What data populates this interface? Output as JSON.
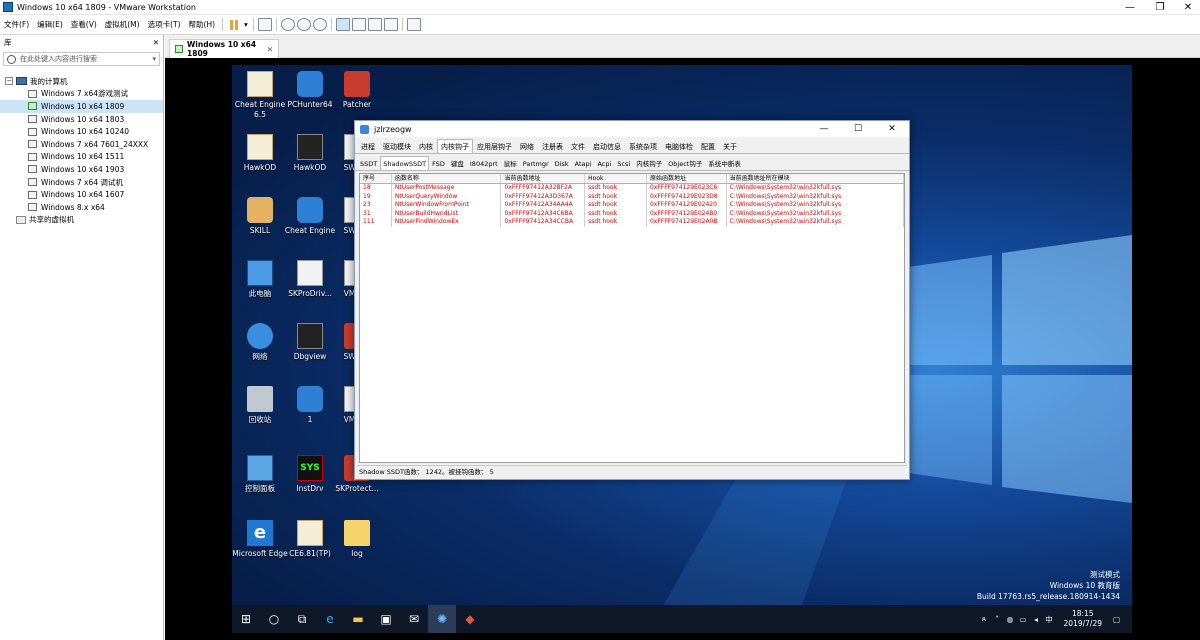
{
  "window": {
    "title": "Windows 10 x64 1809 - VMware Workstation",
    "minimize": "—",
    "maximize": "❐",
    "close": "✕"
  },
  "menu": [
    "文件(F)",
    "编辑(E)",
    "查看(V)",
    "虚拟机(M)",
    "选项卡(T)",
    "帮助(H)"
  ],
  "library": {
    "title": "库",
    "close": "✕",
    "search_placeholder": "在此处键入内容进行搜索",
    "root": "我的计算机",
    "vms": [
      {
        "label": "Windows 7 x64游戏测试",
        "running": false
      },
      {
        "label": "Windows 10 x64 1809",
        "running": true,
        "selected": true
      },
      {
        "label": "Windows 10 x64 1803",
        "running": false
      },
      {
        "label": "Windows 10 x64 10240",
        "running": false
      },
      {
        "label": "Windows 7 x64 7601_24XXX",
        "running": false
      },
      {
        "label": "Windows 10 x64 1511",
        "running": false
      },
      {
        "label": "Windows 10 x64 1903",
        "running": false
      },
      {
        "label": "Windows 7 x64 调试机",
        "running": false
      },
      {
        "label": "Windows 10 x64 1607",
        "running": false
      },
      {
        "label": "Windows 8.x x64",
        "running": false
      }
    ],
    "shared": "共享的虚拟机"
  },
  "vm_tab": {
    "label": "Windows 10 x64 1809",
    "close": "✕"
  },
  "desktop": {
    "icons": [
      {
        "label": "Cheat Engine 6.5",
        "glyph": "doc"
      },
      {
        "label": "PCHunter64",
        "glyph": "blue"
      },
      {
        "label": "Patcher",
        "glyph": "pkg"
      },
      {
        "label": "HawkOD",
        "glyph": "doc"
      },
      {
        "label": "HawkOD",
        "glyph": "dark"
      },
      {
        "label": "SWProt",
        "glyph": "file"
      },
      {
        "label": "SKILL",
        "glyph": "user"
      },
      {
        "label": "Cheat Engine",
        "glyph": "blue"
      },
      {
        "label": "SWProt",
        "glyph": "file"
      },
      {
        "label": "此电脑",
        "glyph": "mon"
      },
      {
        "label": "SKProDriv...",
        "glyph": "file"
      },
      {
        "label": "VMProt",
        "glyph": "file"
      },
      {
        "label": "网络",
        "glyph": "net"
      },
      {
        "label": "Dbgview",
        "glyph": "dark"
      },
      {
        "label": "SWProt",
        "glyph": "pkg"
      },
      {
        "label": "回收站",
        "glyph": "bin"
      },
      {
        "label": "1",
        "glyph": "blue"
      },
      {
        "label": "VMProt",
        "glyph": "file"
      },
      {
        "label": "控制面板",
        "glyph": "ctrl"
      },
      {
        "label": "InstDrv",
        "glyph": "sys",
        "text": "SYS"
      },
      {
        "label": "SKProtect...",
        "glyph": "pkg"
      },
      {
        "label": "Microsoft Edge",
        "glyph": "ie",
        "text": "e"
      },
      {
        "label": "CE6.81(TP)",
        "glyph": "doc"
      },
      {
        "label": "log",
        "glyph": "fold"
      }
    ],
    "watermark": [
      "测试模式",
      "Windows 10 教育版",
      "Build 17763.rs5_release.180914-1434"
    ],
    "clock": {
      "time": "18:15",
      "date": "2019/7/29"
    },
    "ime": "中"
  },
  "tool": {
    "title": "jzlrzeogw",
    "tabs1": [
      "进程",
      "驱动模块",
      "内核",
      "内核钩子",
      "应用层钩子",
      "网络",
      "注册表",
      "文件",
      "启动信息",
      "系统杂项",
      "电脑体检",
      "配置",
      "关于"
    ],
    "tabs1_active": 3,
    "tabs2": [
      "SSDT",
      "ShadowSSDT",
      "FSD",
      "键盘",
      "I8042prt",
      "鼠标",
      "Partmgr",
      "Disk",
      "Atapi",
      "Acpi",
      "Scsi",
      "内核钩子",
      "Object钩子",
      "系统中断表"
    ],
    "tabs2_active": 1,
    "columns": [
      "序号",
      "函数名称",
      "当前函数地址",
      "Hook",
      "原始函数地址",
      "当前函数地址所在模块"
    ],
    "rows": [
      [
        "18",
        "NtUserPostMessage",
        "0xFFFF97412A32BF2A",
        "ssdt hook",
        "0xFFFF974129E023C6",
        "C:\\Windows\\System32\\win32kfull.sys"
      ],
      [
        "19",
        "NtUserQueryWindow",
        "0xFFFF97412A3D367A",
        "ssdt hook",
        "0xFFFF974129E023D8",
        "C:\\Windows\\System32\\win32kfull.sys"
      ],
      [
        "23",
        "NtUserWindowFromPoint",
        "0xFFFF97412A34AA4A",
        "ssdt hook",
        "0xFFFF974129E02420",
        "C:\\Windows\\System32\\win32kfull.sys"
      ],
      [
        "31",
        "NtUserBuildHwndList",
        "0xFFFF97412A34C6BA",
        "ssdt hook",
        "0xFFFF974129E024B0",
        "C:\\Windows\\System32\\win32kfull.sys"
      ],
      [
        "111",
        "NtUserFindWindowEx",
        "0xFFFF97412A34CCBA",
        "ssdt hook",
        "0xFFFF974129E02A0B",
        "C:\\Windows\\System32\\win32kfull.sys"
      ]
    ],
    "status": "Shadow SSDT函数： 1242。被挂钩函数： 5"
  }
}
